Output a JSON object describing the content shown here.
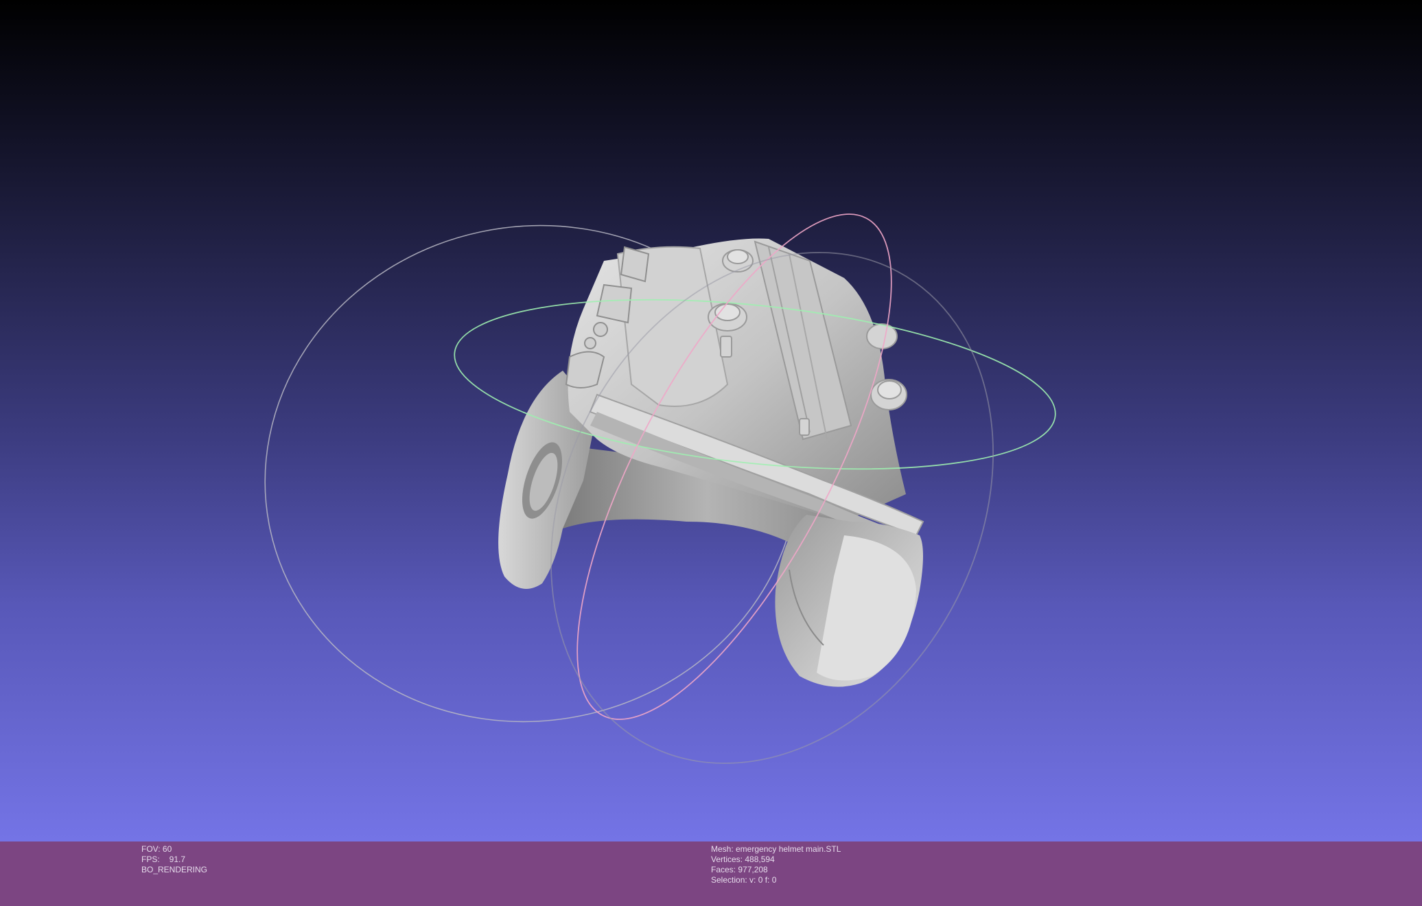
{
  "viewport": {
    "background_top": "#000000",
    "background_bottom": "#7474e6",
    "trackball_colors": {
      "x_ring": "#b8b8c4",
      "y_ring": "#9ef0b0",
      "z_ring": "#f0a6c8"
    },
    "model_color": "#c8c8c8"
  },
  "status": {
    "bar_color": "#7c4582",
    "fov": "FOV: 60",
    "fps_label": "FPS:",
    "fps_value": "91.7",
    "mode": "BO_RENDERING",
    "mesh": "Mesh: emergency helmet main.STL",
    "vertices": "Vertices: 488,594",
    "faces": "Faces: 977,208",
    "selection": "Selection: v: 0 f: 0"
  }
}
